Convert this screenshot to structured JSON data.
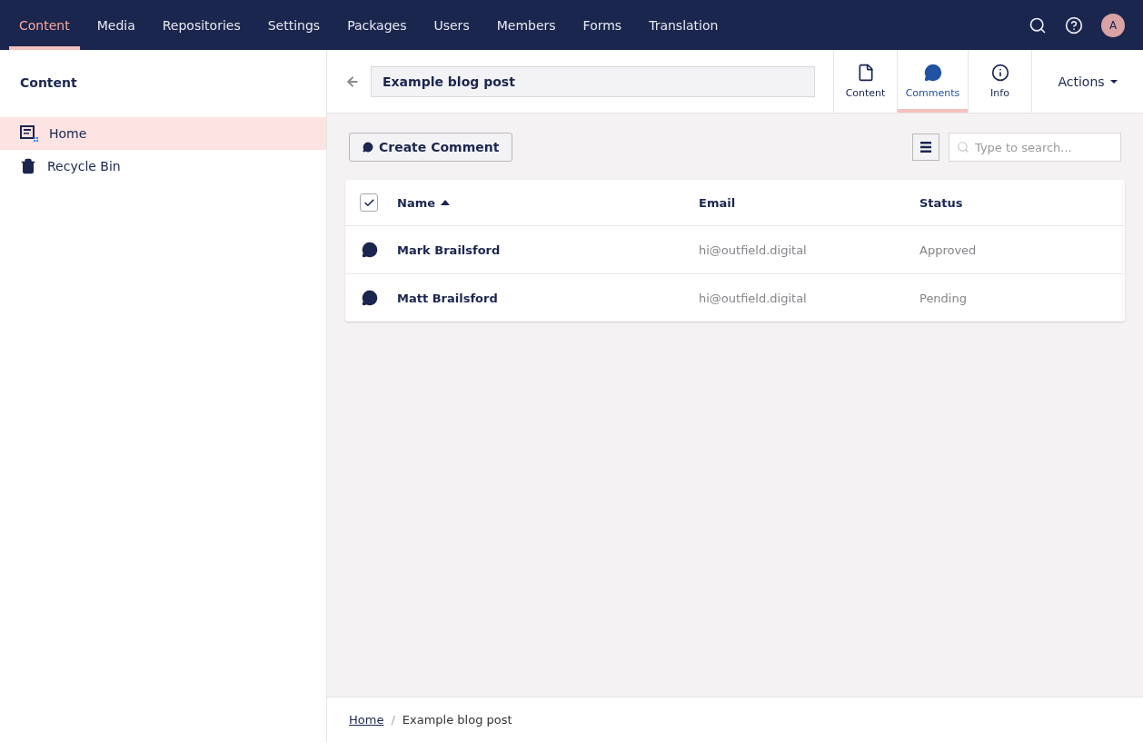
{
  "top_nav": {
    "sections": [
      {
        "label": "Content",
        "selected": true
      },
      {
        "label": "Media",
        "selected": false
      },
      {
        "label": "Repositories",
        "selected": false
      },
      {
        "label": "Settings",
        "selected": false
      },
      {
        "label": "Packages",
        "selected": false
      },
      {
        "label": "Users",
        "selected": false
      },
      {
        "label": "Members",
        "selected": false
      },
      {
        "label": "Forms",
        "selected": false
      },
      {
        "label": "Translation",
        "selected": false
      }
    ],
    "avatar": "A"
  },
  "sidebar": {
    "title": "Content",
    "items": [
      {
        "label": "Home",
        "kind": "home",
        "selected": true
      },
      {
        "label": "Recycle Bin",
        "kind": "bin",
        "selected": false
      }
    ]
  },
  "editor": {
    "name": "Example blog post",
    "apps": [
      {
        "label": "Content",
        "kind": "document",
        "selected": false
      },
      {
        "label": "Comments",
        "kind": "comment",
        "selected": true
      },
      {
        "label": "Info",
        "kind": "info",
        "selected": false
      }
    ],
    "actions": "Actions"
  },
  "toolbar": {
    "create_button": "Create Comment",
    "search": {
      "placeholder": "Type to search..."
    }
  },
  "table": {
    "select_all_checked": true,
    "columns": [
      {
        "label": "Name",
        "sorted": true
      },
      {
        "label": "Email",
        "sorted": false
      },
      {
        "label": "Status",
        "sorted": false
      }
    ],
    "rows": [
      {
        "name": "Mark Brailsford",
        "email": "hi@outfield.digital",
        "status": "Approved"
      },
      {
        "name": "Matt Brailsford",
        "email": "hi@outfield.digital",
        "status": "Pending"
      }
    ]
  },
  "breadcrumb": {
    "items": [
      "Home",
      "Example blog post"
    ],
    "separator": "/"
  }
}
